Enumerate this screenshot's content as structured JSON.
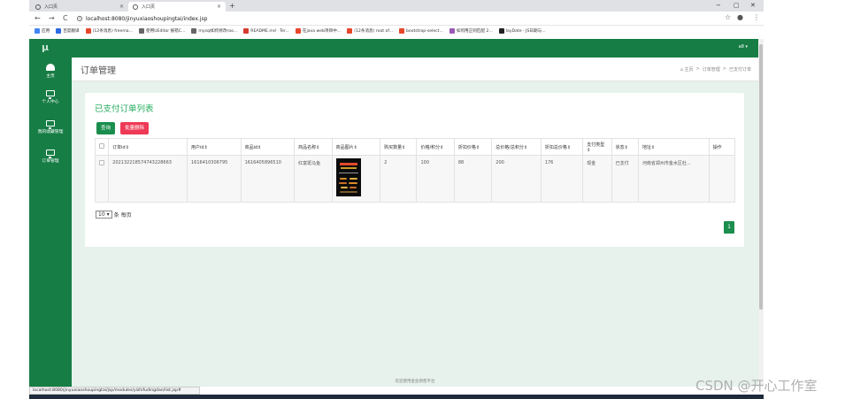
{
  "browser": {
    "tabs": [
      {
        "label": "入口页",
        "active": false
      },
      {
        "label": "入口页",
        "active": true
      }
    ],
    "new_tab": "+",
    "window_controls": [
      "−",
      "▢",
      "✕"
    ],
    "nav": {
      "back": "←",
      "forward": "→",
      "reload": "C"
    },
    "url": "localhost:8080/jinyuxiaoshoupingtai/index.jsp",
    "bookmarks": [
      {
        "label": "应用",
        "color": "#4285f4"
      },
      {
        "label": "百度翻译",
        "color": "#2d6ae3"
      },
      {
        "label": "(12条消息) freema...",
        "color": "#e8462b"
      },
      {
        "label": "使用UEditor 报错C...",
        "color": "#666666"
      },
      {
        "label": "mysql如何修改roo...",
        "color": "#666666"
      },
      {
        "label": "README.md · Ter...",
        "color": "#d63b2f"
      },
      {
        "label": "在java web项目中...",
        "color": "#e8462b"
      },
      {
        "label": "(12条消息) root of...",
        "color": "#e8462b"
      },
      {
        "label": "bootstrap-select...",
        "color": "#e8462b"
      },
      {
        "label": "如何用正则匹配 2...",
        "color": "#9b59b6"
      },
      {
        "label": "layDate - JS日期与...",
        "color": "#222222"
      }
    ],
    "status_url": "localhost:8080/jinyuxiaoshoupingtai/jsp/modules/yizhifudingdan/list.jsp#"
  },
  "app": {
    "logo": "μ",
    "user_menu": "a8 ▾",
    "sidebar": [
      {
        "label": "主页",
        "icon": "dashboard-icon"
      },
      {
        "label": "个人中心",
        "icon": "monitor-icon"
      },
      {
        "label": "我的收藏管理",
        "icon": "monitor-icon"
      },
      {
        "label": "订单管理",
        "icon": "monitor-icon"
      }
    ],
    "page_title": "订单管理",
    "breadcrumb": [
      "⌂ 主页",
      ">",
      "订单管理",
      ">",
      "已支付订单"
    ],
    "panel": {
      "title": "已支付订单列表",
      "query_button": "查询",
      "batch_delete_button": "批量删除",
      "columns": [
        "订单id⇕",
        "用户id⇕",
        "商品id⇕",
        "商品名称⇕",
        "商品图片⇕",
        "购买数量⇕",
        "价格/积分⇕",
        "折扣价格⇕",
        "总价格/总积分⇕",
        "折扣总价格⇕",
        "支付类型⇕",
        "状态⇕",
        "地址⇕",
        "操作"
      ],
      "rows": [
        {
          "order_id": "202132218574743228663",
          "user_id": "1616410306795",
          "product_id": "1616405896510",
          "product_name": "红富斑马鱼",
          "image_caption": "斑马鱼",
          "quantity": "2",
          "price": "100",
          "discount_price": "88",
          "total": "200",
          "discount_total": "176",
          "pay_type": "现金",
          "status": "已支付",
          "address": "河南省郑州市金水区杜...",
          "action": ""
        }
      ],
      "page_size": "10",
      "page_size_suffix": "条 每页",
      "current_page": "1"
    },
    "footer": "欢迎使用金鱼销售平台"
  },
  "watermark": "CSDN @开心工作室"
}
